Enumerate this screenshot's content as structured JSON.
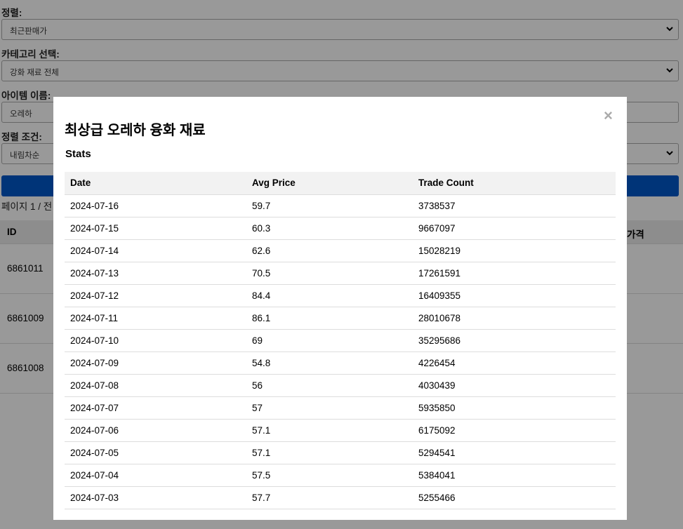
{
  "form": {
    "sort_label": "정렬:",
    "sort_value": "최근판매가",
    "category_label": "카테고리 선택:",
    "category_value": "강화 재료 전체",
    "item_name_label": "아이템 이름:",
    "item_name_value": "오레하",
    "order_label": "정렬 조건:",
    "order_value": "내림차순"
  },
  "page_info": "페이지 1 / 전",
  "results": {
    "headers": {
      "id": "ID",
      "price": "가격"
    },
    "rows": [
      {
        "id": "6861011"
      },
      {
        "id": "6861009"
      },
      {
        "id": "6861008"
      }
    ]
  },
  "modal": {
    "title": "최상급 오레하 융화 재료",
    "close_symbol": "×",
    "subtitle": "Stats",
    "columns": [
      "Date",
      "Avg Price",
      "Trade Count"
    ],
    "rows": [
      [
        "2024-07-16",
        "59.7",
        "3738537"
      ],
      [
        "2024-07-15",
        "60.3",
        "9667097"
      ],
      [
        "2024-07-14",
        "62.6",
        "15028219"
      ],
      [
        "2024-07-13",
        "70.5",
        "17261591"
      ],
      [
        "2024-07-12",
        "84.4",
        "16409355"
      ],
      [
        "2024-07-11",
        "86.1",
        "28010678"
      ],
      [
        "2024-07-10",
        "69",
        "35295686"
      ],
      [
        "2024-07-09",
        "54.8",
        "4226454"
      ],
      [
        "2024-07-08",
        "56",
        "4030439"
      ],
      [
        "2024-07-07",
        "57",
        "5935850"
      ],
      [
        "2024-07-06",
        "57.1",
        "6175092"
      ],
      [
        "2024-07-05",
        "57.1",
        "5294541"
      ],
      [
        "2024-07-04",
        "57.5",
        "5384041"
      ],
      [
        "2024-07-03",
        "57.7",
        "5255466"
      ]
    ]
  },
  "colors": {
    "search_button": "#0057c8",
    "overlay": "rgba(0,0,0,0.4)"
  }
}
